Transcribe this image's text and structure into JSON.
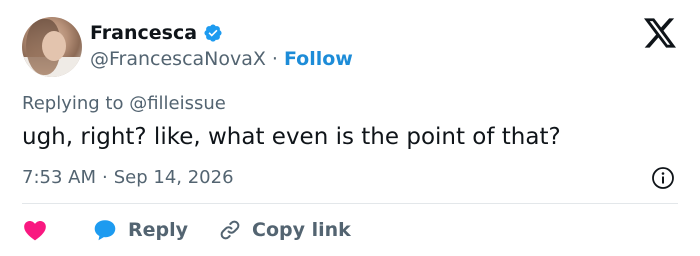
{
  "author": {
    "display_name": "Francesca",
    "handle": "@FrancescaNovaX",
    "separator": "·",
    "follow_label": "Follow"
  },
  "tweet": {
    "replying_to": "Replying to @filleissue",
    "text": "ugh, right? like, what even is the point of that?",
    "time": "7:53 AM",
    "separator": "·",
    "date": "Sep 14, 2026"
  },
  "actions": {
    "reply_label": "Reply",
    "copy_link_label": "Copy link"
  },
  "icons": {
    "verified": "verified-badge-icon",
    "logo": "x-logo-icon",
    "info": "info-icon",
    "like": "heart-icon",
    "reply": "reply-bubble-icon",
    "link": "link-icon"
  },
  "colors": {
    "verified": "#1d9bf0",
    "follow": "#1d8cd8",
    "heart": "#f91880",
    "reply": "#1d9bf0",
    "muted": "#536471",
    "text": "#0f1419"
  }
}
